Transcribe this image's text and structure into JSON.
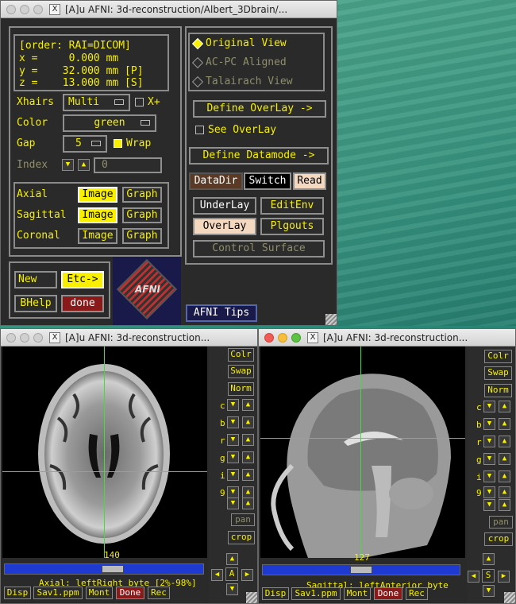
{
  "main_window": {
    "title": "[A]u AFNI: 3d-reconstruction/Albert_3Dbrain/...",
    "coords": {
      "order": "[order: RAI=DICOM]",
      "x": "x =     0.000 mm",
      "y": "y =    32.000 mm [P]",
      "z": "z =    13.000 mm [S]"
    },
    "xhairs_label": "Xhairs",
    "xhairs_value": "Multi",
    "xplus_label": "X+",
    "color_label": "Color",
    "color_value": "green",
    "gap_label": "Gap",
    "gap_value": "5",
    "wrap_label": "Wrap",
    "index_label": "Index",
    "index_value": "0",
    "views": [
      {
        "label": "Axial",
        "image": "Image",
        "graph": "Graph"
      },
      {
        "label": "Sagittal",
        "image": "Image",
        "graph": "Graph"
      },
      {
        "label": "Coronal",
        "image": "Image",
        "graph": "Graph"
      }
    ],
    "new_label": "New",
    "etc_label": "Etc->",
    "bhelp_label": "BHelp",
    "done_label": "done",
    "logo_text": "AFNI",
    "radio_original": "Original View",
    "radio_acpc": "AC-PC Aligned",
    "radio_talairach": "Talairach View",
    "define_overlay": "Define OverLay ->",
    "see_overlay": "See OverLay",
    "define_datamode": "Define Datamode ->",
    "datadir": "DataDir",
    "switch": "Switch",
    "read": "Read",
    "underlay": "UnderLay",
    "editenv": "EditEnv",
    "overlay": "OverLay",
    "plugouts": "Plgouts",
    "control_surface": "Control Surface",
    "tips": "AFNI Tips"
  },
  "axial_window": {
    "title": "[A]u AFNI: 3d-reconstruction...",
    "slice_number": "140",
    "status": "Axial: leftRight byte [2%-98%]",
    "side_buttons": [
      "Colr",
      "Swap",
      "Norm"
    ],
    "side_letters": [
      "c",
      "b",
      "r",
      "g",
      "i",
      "9"
    ],
    "pan": "pan",
    "crop": "crop",
    "orient_letter": "A",
    "bottom_buttons": [
      "Disp",
      "Sav1.ppm",
      "Mont",
      "Done",
      "Rec"
    ]
  },
  "sagittal_window": {
    "title": "[A]u AFNI: 3d-reconstruction...",
    "slice_number": "127",
    "status": "Sagittal: leftAnterior byte",
    "side_buttons": [
      "Colr",
      "Swap",
      "Norm"
    ],
    "side_letters": [
      "c",
      "b",
      "r",
      "g",
      "i",
      "9"
    ],
    "pan": "pan",
    "crop": "crop",
    "orient_letter": "S",
    "bottom_buttons": [
      "Disp",
      "Sav1.ppm",
      "Mont",
      "Done",
      "Rec"
    ]
  },
  "colors": {
    "accent": "#f7f000",
    "crosshair": "#3ee03e",
    "panel": "#2c2c2c"
  }
}
